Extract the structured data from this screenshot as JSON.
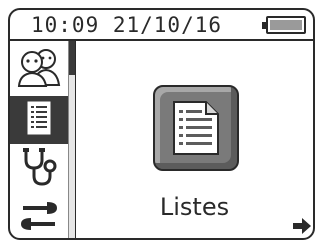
{
  "status_bar": {
    "datetime": "10:09 21/10/16",
    "battery_level": 1.0
  },
  "sidebar": {
    "items": [
      {
        "icon": "people-icon",
        "selected": false
      },
      {
        "icon": "list-icon",
        "selected": true
      },
      {
        "icon": "stethoscope-icon",
        "selected": false
      },
      {
        "icon": "wrench-icon",
        "selected": false
      }
    ]
  },
  "main": {
    "label": "Listes",
    "icon": "document-list-icon"
  },
  "navigation": {
    "next_icon": "arrow-right-icon"
  }
}
